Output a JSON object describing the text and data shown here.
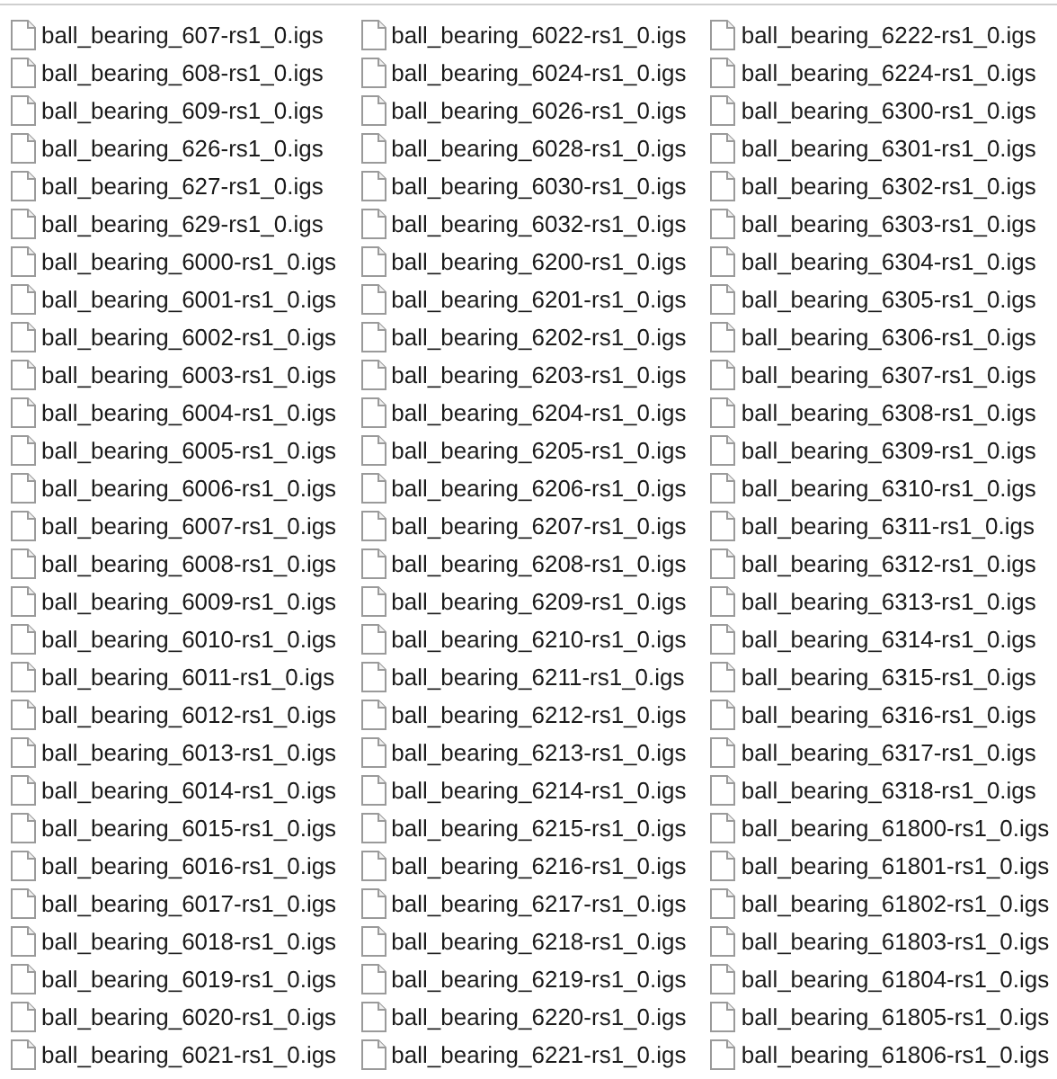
{
  "columns": [
    {
      "files": [
        "ball_bearing_607-rs1_0.igs",
        "ball_bearing_608-rs1_0.igs",
        "ball_bearing_609-rs1_0.igs",
        "ball_bearing_626-rs1_0.igs",
        "ball_bearing_627-rs1_0.igs",
        "ball_bearing_629-rs1_0.igs",
        "ball_bearing_6000-rs1_0.igs",
        "ball_bearing_6001-rs1_0.igs",
        "ball_bearing_6002-rs1_0.igs",
        "ball_bearing_6003-rs1_0.igs",
        "ball_bearing_6004-rs1_0.igs",
        "ball_bearing_6005-rs1_0.igs",
        "ball_bearing_6006-rs1_0.igs",
        "ball_bearing_6007-rs1_0.igs",
        "ball_bearing_6008-rs1_0.igs",
        "ball_bearing_6009-rs1_0.igs",
        "ball_bearing_6010-rs1_0.igs",
        "ball_bearing_6011-rs1_0.igs",
        "ball_bearing_6012-rs1_0.igs",
        "ball_bearing_6013-rs1_0.igs",
        "ball_bearing_6014-rs1_0.igs",
        "ball_bearing_6015-rs1_0.igs",
        "ball_bearing_6016-rs1_0.igs",
        "ball_bearing_6017-rs1_0.igs",
        "ball_bearing_6018-rs1_0.igs",
        "ball_bearing_6019-rs1_0.igs",
        "ball_bearing_6020-rs1_0.igs",
        "ball_bearing_6021-rs1_0.igs"
      ]
    },
    {
      "files": [
        "ball_bearing_6022-rs1_0.igs",
        "ball_bearing_6024-rs1_0.igs",
        "ball_bearing_6026-rs1_0.igs",
        "ball_bearing_6028-rs1_0.igs",
        "ball_bearing_6030-rs1_0.igs",
        "ball_bearing_6032-rs1_0.igs",
        "ball_bearing_6200-rs1_0.igs",
        "ball_bearing_6201-rs1_0.igs",
        "ball_bearing_6202-rs1_0.igs",
        "ball_bearing_6203-rs1_0.igs",
        "ball_bearing_6204-rs1_0.igs",
        "ball_bearing_6205-rs1_0.igs",
        "ball_bearing_6206-rs1_0.igs",
        "ball_bearing_6207-rs1_0.igs",
        "ball_bearing_6208-rs1_0.igs",
        "ball_bearing_6209-rs1_0.igs",
        "ball_bearing_6210-rs1_0.igs",
        "ball_bearing_6211-rs1_0.igs",
        "ball_bearing_6212-rs1_0.igs",
        "ball_bearing_6213-rs1_0.igs",
        "ball_bearing_6214-rs1_0.igs",
        "ball_bearing_6215-rs1_0.igs",
        "ball_bearing_6216-rs1_0.igs",
        "ball_bearing_6217-rs1_0.igs",
        "ball_bearing_6218-rs1_0.igs",
        "ball_bearing_6219-rs1_0.igs",
        "ball_bearing_6220-rs1_0.igs",
        "ball_bearing_6221-rs1_0.igs"
      ]
    },
    {
      "files": [
        "ball_bearing_6222-rs1_0.igs",
        "ball_bearing_6224-rs1_0.igs",
        "ball_bearing_6300-rs1_0.igs",
        "ball_bearing_6301-rs1_0.igs",
        "ball_bearing_6302-rs1_0.igs",
        "ball_bearing_6303-rs1_0.igs",
        "ball_bearing_6304-rs1_0.igs",
        "ball_bearing_6305-rs1_0.igs",
        "ball_bearing_6306-rs1_0.igs",
        "ball_bearing_6307-rs1_0.igs",
        "ball_bearing_6308-rs1_0.igs",
        "ball_bearing_6309-rs1_0.igs",
        "ball_bearing_6310-rs1_0.igs",
        "ball_bearing_6311-rs1_0.igs",
        "ball_bearing_6312-rs1_0.igs",
        "ball_bearing_6313-rs1_0.igs",
        "ball_bearing_6314-rs1_0.igs",
        "ball_bearing_6315-rs1_0.igs",
        "ball_bearing_6316-rs1_0.igs",
        "ball_bearing_6317-rs1_0.igs",
        "ball_bearing_6318-rs1_0.igs",
        "ball_bearing_61800-rs1_0.igs",
        "ball_bearing_61801-rs1_0.igs",
        "ball_bearing_61802-rs1_0.igs",
        "ball_bearing_61803-rs1_0.igs",
        "ball_bearing_61804-rs1_0.igs",
        "ball_bearing_61805-rs1_0.igs",
        "ball_bearing_61806-rs1_0.igs"
      ]
    }
  ]
}
